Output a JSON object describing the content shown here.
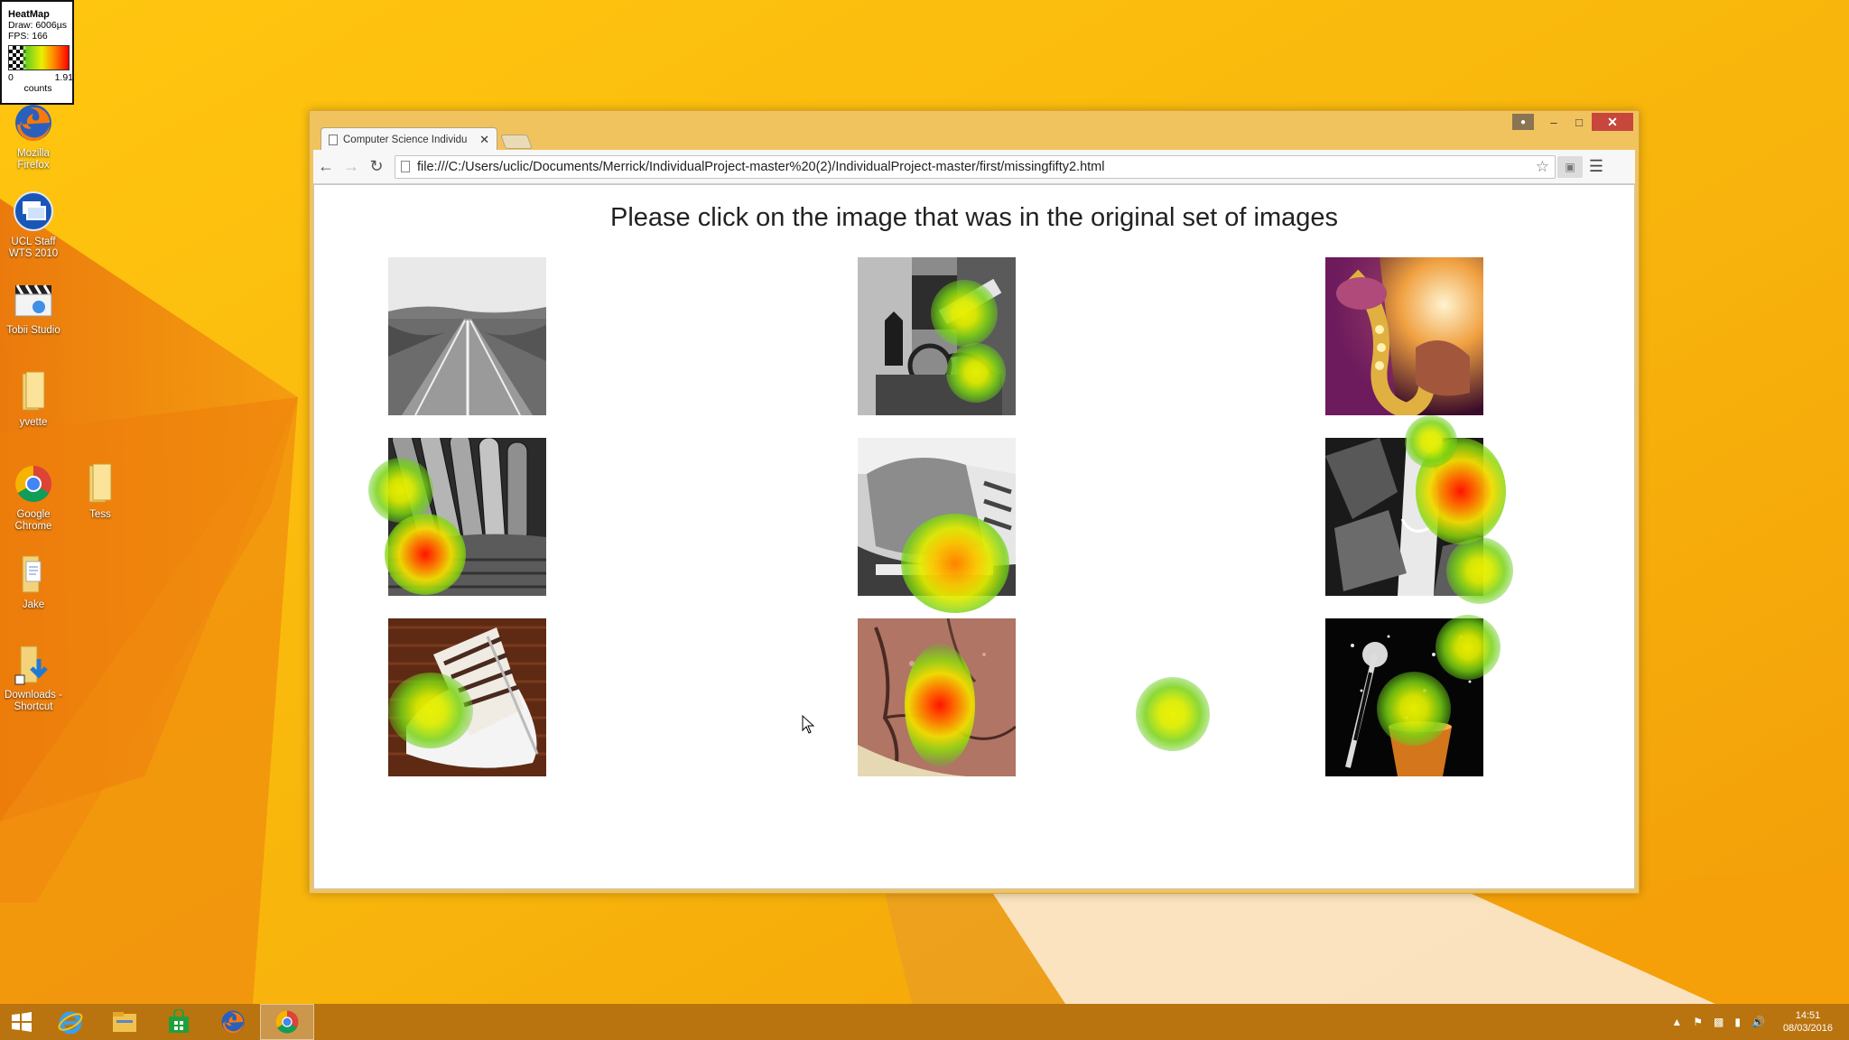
{
  "heatmap_legend": {
    "title": "HeatMap",
    "draw": "Draw: 6006µs",
    "fps": "FPS: 166",
    "min": "0",
    "max": "1.91",
    "unit": "counts"
  },
  "desktop_icons": [
    {
      "label": "Mozilla Firefox",
      "icon": "firefox-icon"
    },
    {
      "label": "UCL Staff WTS 2010",
      "icon": "remote-desktop-icon"
    },
    {
      "label": "Tobii Studio",
      "icon": "tobii-studio-icon"
    },
    {
      "label": "yvette",
      "icon": "folder-icon"
    },
    {
      "label": "Google Chrome",
      "icon": "chrome-icon"
    },
    {
      "label": "Tess",
      "icon": "folder-icon"
    },
    {
      "label": "Jake",
      "icon": "document-icon"
    },
    {
      "label": "Downloads - Shortcut",
      "icon": "downloads-shortcut-icon"
    }
  ],
  "browser": {
    "tab_title": "Computer Science Individu",
    "url": "file:///C:/Users/uclic/Documents/Merrick/IndividualProject-master%20(2)/IndividualProject-master/first/missingfifty2.html"
  },
  "page": {
    "heading": "Please click on the image that was in the original set of images",
    "images": [
      {
        "subject": "road"
      },
      {
        "subject": "street-lamp"
      },
      {
        "subject": "saxophone"
      },
      {
        "subject": "carrots"
      },
      {
        "subject": "bread"
      },
      {
        "subject": "waterfall-rocks"
      },
      {
        "subject": "cake"
      },
      {
        "subject": "stone-wall"
      },
      {
        "subject": "magic-wand"
      }
    ]
  },
  "taskbar": {
    "items": [
      "start-button",
      "internet-explorer-icon",
      "file-explorer-icon",
      "store-icon",
      "firefox-icon",
      "chrome-icon"
    ],
    "active": "chrome-icon",
    "time": "14:51",
    "date": "08/03/2016"
  },
  "colors": {
    "desktop": "#f7b40c",
    "window_frame": "#f1c35e",
    "close_button": "#c7473d",
    "heat_low": "#8fd619",
    "heat_mid": "#e6ef00",
    "heat_high": "#ff1a00"
  }
}
